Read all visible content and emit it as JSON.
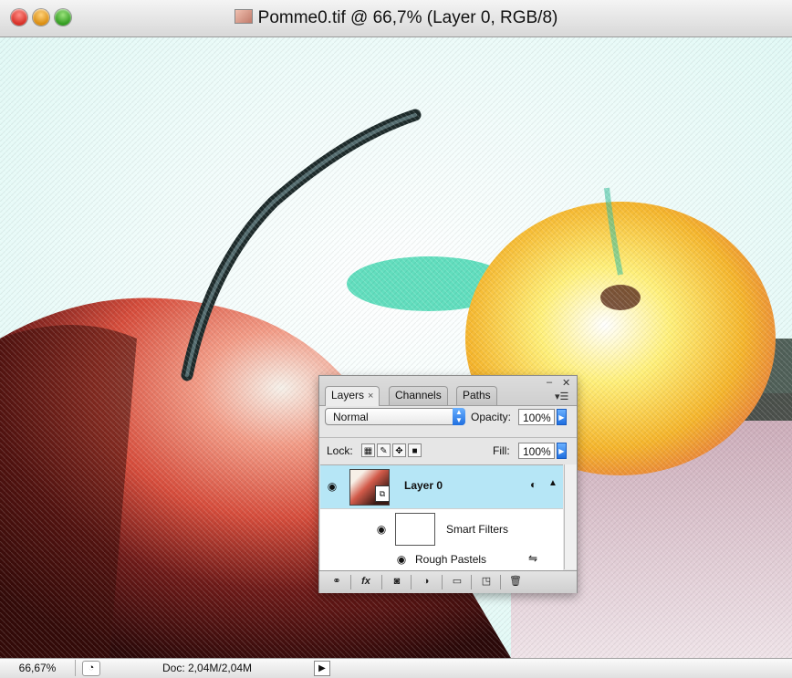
{
  "window": {
    "title": "Pomme0.tif @ 66,7% (Layer 0, RGB/8)"
  },
  "statusbar": {
    "zoom": "66,67%",
    "doc_size": "Doc: 2,04M/2,04M"
  },
  "layers_panel": {
    "tabs": [
      {
        "label": "Layers",
        "active": true
      },
      {
        "label": "Channels",
        "active": false
      },
      {
        "label": "Paths",
        "active": false
      }
    ],
    "tab_close": "×",
    "blend_mode": "Normal",
    "opacity_label": "Opacity:",
    "opacity_value": "100%",
    "lock_label": "Lock:",
    "fill_label": "Fill:",
    "fill_value": "100%",
    "layers": [
      {
        "name": "Layer 0",
        "selected": true,
        "visible": true,
        "smart_object": true
      },
      {
        "name": "Smart Filters",
        "visible": true
      },
      {
        "name": "Rough Pastels",
        "visible": true
      }
    ],
    "bottom_icons": [
      "link-icon",
      "fx-icon",
      "mask-icon",
      "adjustment-icon",
      "folder-icon",
      "new-layer-icon",
      "trash-icon"
    ],
    "fx_label": "fx"
  },
  "colors": {
    "selection_highlight": "#b6e6f6",
    "close": "#d52b22",
    "minimize": "#d88a0c",
    "zoom": "#2f9a1d"
  }
}
